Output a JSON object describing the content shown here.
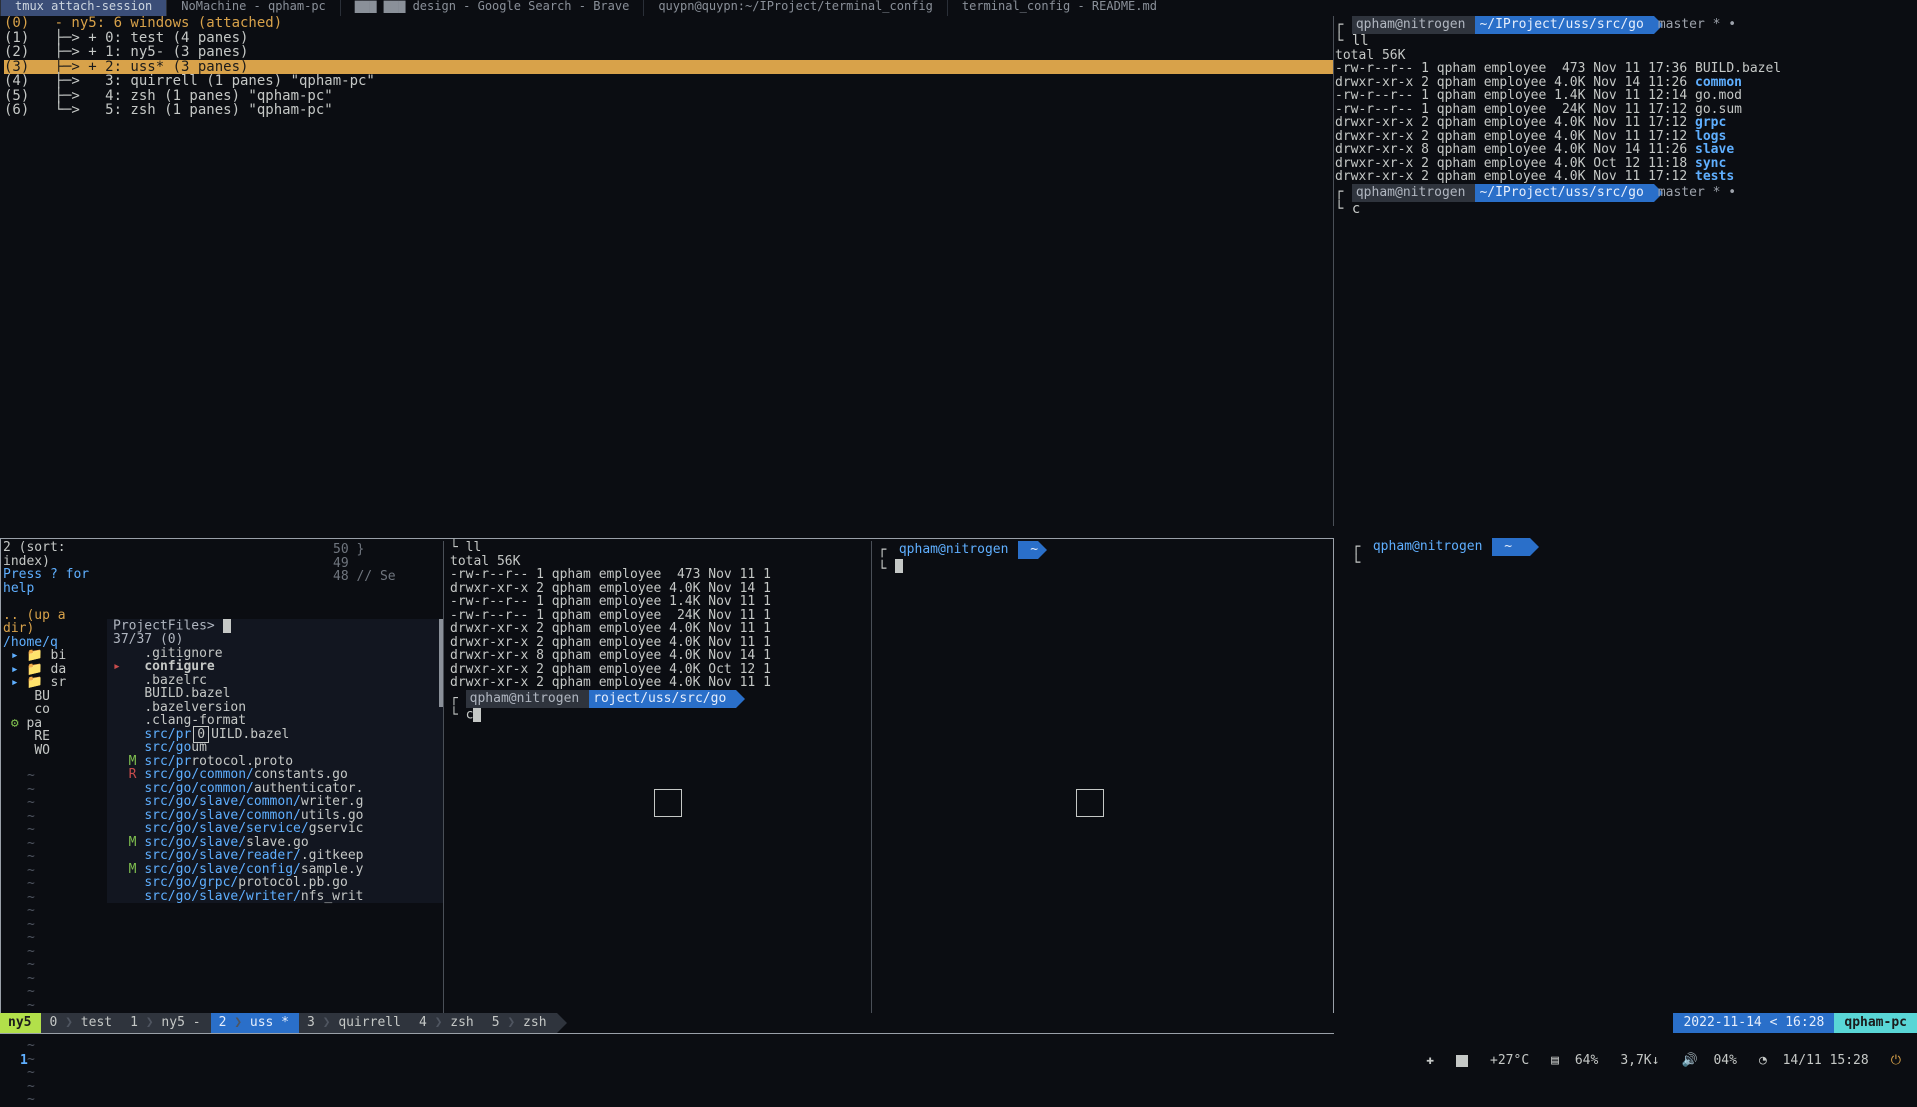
{
  "taskbar": {
    "tabs": [
      {
        "label": "tmux attach-session",
        "active": true
      },
      {
        "label": "NoMachine - qpham-pc"
      },
      {
        "label": "▇▇▇ ▇▇▇ design - Google Search - Brave"
      },
      {
        "label": "quypn@quypn:~/IProject/terminal_config"
      },
      {
        "label": "terminal_config - README.md"
      }
    ]
  },
  "tmux_attach": {
    "header": "(0)   - ny5: 6 windows (attached)",
    "lines": [
      "(1)   ├─> + 0: test (4 panes)",
      "(2)   ├─> + 1: ny5- (3 panes)",
      "(3)   ├─> + 2: uss* (3 panes)",
      "(4)   ├─>   3: quirrell (1 panes) \"qpham-pc\"",
      "(5)   ├─>   4: zsh (1 panes) \"qpham-pc\"",
      "(6)   └─>   5: zsh (1 panes) \"qpham-pc\""
    ],
    "selected_index": 2
  },
  "right_top": {
    "prompt_user": "qpham@nitrogen",
    "prompt_path": "~/IProject/uss/src/go",
    "git": "master * •",
    "cmd": "ll",
    "total": "total 56K",
    "entries": [
      {
        "perm": "-rw-r--r-- 1",
        "own": "qpham employee",
        "size": " 473",
        "date": "Nov 11 17:36",
        "name": "BUILD.bazel",
        "dir": false
      },
      {
        "perm": "drwxr-xr-x 2",
        "own": "qpham employee",
        "size": "4.0K",
        "date": "Nov 14 11:26",
        "name": "common",
        "dir": true
      },
      {
        "perm": "-rw-r--r-- 1",
        "own": "qpham employee",
        "size": "1.4K",
        "date": "Nov 11 12:14",
        "name": "go.mod",
        "dir": false
      },
      {
        "perm": "-rw-r--r-- 1",
        "own": "qpham employee",
        "size": " 24K",
        "date": "Nov 11 17:12",
        "name": "go.sum",
        "dir": false
      },
      {
        "perm": "drwxr-xr-x 2",
        "own": "qpham employee",
        "size": "4.0K",
        "date": "Nov 11 17:12",
        "name": "grpc",
        "dir": true
      },
      {
        "perm": "drwxr-xr-x 2",
        "own": "qpham employee",
        "size": "4.0K",
        "date": "Nov 11 17:12",
        "name": "logs",
        "dir": true
      },
      {
        "perm": "drwxr-xr-x 8",
        "own": "qpham employee",
        "size": "4.0K",
        "date": "Nov 14 11:26",
        "name": "slave",
        "dir": true
      },
      {
        "perm": "drwxr-xr-x 2",
        "own": "qpham employee",
        "size": "4.0K",
        "date": "Oct 12 11:18",
        "name": "sync",
        "dir": true
      },
      {
        "perm": "drwxr-xr-x 2",
        "own": "qpham employee",
        "size": "4.0K",
        "date": "Nov 11 17:12",
        "name": "tests",
        "dir": true
      }
    ],
    "cmd2": "c"
  },
  "editor": {
    "sort_line": "2 (sort: index)",
    "help": "Press ? for help",
    "updir": ".. (up a dir)",
    "path": "/home/q",
    "tree": [
      {
        "icon": "fold",
        "name": "bi"
      },
      {
        "icon": "fold",
        "name": "da"
      },
      {
        "icon": "fold",
        "name": "sr"
      },
      {
        "icon": "file",
        "name": "BU"
      },
      {
        "icon": "file",
        "name": "co"
      },
      {
        "icon": "gear",
        "name": "pa"
      },
      {
        "icon": "file",
        "name": "RE"
      },
      {
        "icon": "file",
        "name": "WO"
      }
    ],
    "code_lines": [
      {
        "num": "50",
        "text": "}"
      },
      {
        "num": "49",
        "text": ""
      },
      {
        "num": "48",
        "text": "// Se"
      }
    ],
    "project": {
      "prompt": "ProjectFiles>",
      "count": "37/37 (0)",
      "rows": [
        {
          "status": "",
          "path": "",
          "file": ".gitignore"
        },
        {
          "status": "sel",
          "path": "",
          "file": "configure"
        },
        {
          "status": "",
          "path": "",
          "file": ".bazelrc"
        },
        {
          "status": "",
          "path": "",
          "file": "BUILD.bazel"
        },
        {
          "status": "",
          "path": "",
          "file": ".bazelversion"
        },
        {
          "status": "",
          "path": "",
          "file": ".clang-format"
        },
        {
          "status": "",
          "path": "src/pr",
          "file": "UILD.bazel",
          "box": true,
          "boxtext": "0"
        },
        {
          "status": "",
          "path": "src/go",
          "file": "um"
        },
        {
          "status": "M",
          "path": "src/pr",
          "file": "rotocol.proto"
        },
        {
          "status": "R",
          "path": "src/go/common/",
          "file": "constants.go"
        },
        {
          "status": "",
          "path": "src/go/common/",
          "file": "authenticator."
        },
        {
          "status": "",
          "path": "src/go/slave/common/",
          "file": "writer.g"
        },
        {
          "status": "",
          "path": "src/go/slave/common/",
          "file": "utils.go"
        },
        {
          "status": "",
          "path": "src/go/slave/service/",
          "file": "gservic"
        },
        {
          "status": "M",
          "path": "src/go/slave/",
          "file": "slave.go"
        },
        {
          "status": "",
          "path": "src/go/slave/reader/",
          "file": ".gitkeep"
        },
        {
          "status": "M",
          "path": "src/go/slave/config/",
          "file": "sample.y"
        },
        {
          "status": "",
          "path": "src/go/grpc/",
          "file": "protocol.pb.go"
        },
        {
          "status": "",
          "path": "src/go/slave/writer/",
          "file": "nfs_writ"
        }
      ]
    },
    "mid_pane": {
      "cmd": "ll",
      "total": "total 56K",
      "rows": [
        "-rw-r--r-- 1 qpham employee  473 Nov 11 1",
        "drwxr-xr-x 2 qpham employee 4.0K Nov 14 1",
        "-rw-r--r-- 1 qpham employee 1.4K Nov 11 1",
        "-rw-r--r-- 1 qpham employee  24K Nov 11 1",
        "drwxr-xr-x 2 qpham employee 4.0K Nov 11 1",
        "drwxr-xr-x 2 qpham employee 4.0K Nov 11 1",
        "drwxr-xr-x 8 qpham employee 4.0K Nov 14 1",
        "drwxr-xr-x 2 qpham employee 4.0K Oct 12 1",
        "drwxr-xr-x 2 qpham employee 4.0K Nov 11 1"
      ],
      "prompt_user": "qpham@nitrogen",
      "prompt_path": "roject/uss/src/go",
      "cmd2": "c"
    },
    "right_small": {
      "prompt_user": "qpham@nitrogen"
    }
  },
  "right_bottom": {
    "prompt_user": "qpham@nitrogen"
  },
  "statusbar": {
    "session": "ny5",
    "windows": [
      {
        "idx": "0",
        "name": "test"
      },
      {
        "idx": "1",
        "name": "ny5 -"
      },
      {
        "idx": "2",
        "name": "uss *",
        "active": true
      },
      {
        "idx": "3",
        "name": "quirrell"
      },
      {
        "idx": "4",
        "name": "zsh"
      },
      {
        "idx": "5",
        "name": "zsh"
      }
    ],
    "date": "2022-11-14",
    "time": "16:28",
    "host": "qpham-pc"
  },
  "tray": {
    "ws": "1",
    "temp": "+27°C",
    "cpu": "64%",
    "net": "3,7K↓",
    "vol": "04%",
    "date": "14/11 15:28"
  }
}
